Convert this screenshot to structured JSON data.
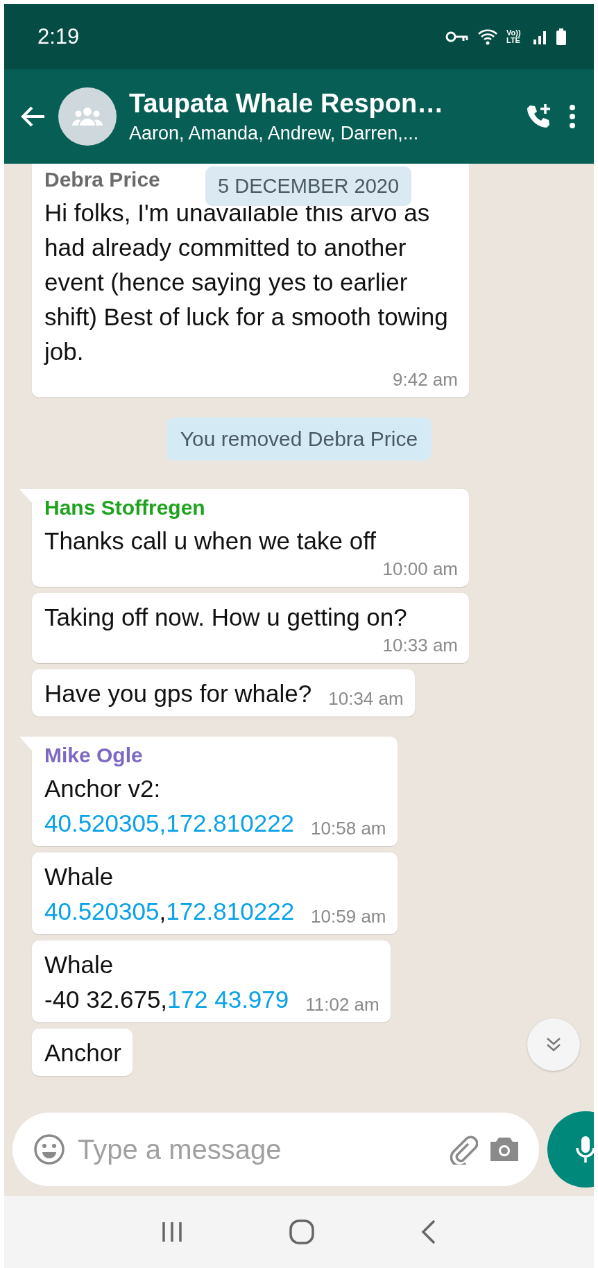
{
  "status_bar": {
    "time": "2:19",
    "volte": "Vo)) LTE"
  },
  "header": {
    "title": "Taupata Whale Respon…",
    "subtitle": "Aaron, Amanda, Andrew, Darren,..."
  },
  "date_chip": "5 DECEMBER 2020",
  "messages": [
    {
      "kind": "incoming",
      "tail": false,
      "sender": "Debra Price",
      "color": "#6b6b6b",
      "lines": [
        [
          {
            "text": "Hi folks, I'm unavailable  this arvo as had already committed to another event (hence saying yes to earlier shift) Best of luck for a smooth towing job.",
            "link": false
          }
        ]
      ],
      "time": "9:42 am"
    },
    {
      "kind": "system",
      "text": "You removed Debra Price"
    },
    {
      "kind": "incoming",
      "tail": true,
      "sender": "Hans Stoffregen",
      "color": "#1fa31f",
      "lines": [
        [
          {
            "text": "Thanks call u when we take off",
            "link": false
          }
        ]
      ],
      "time": "10:00 am"
    },
    {
      "kind": "incoming",
      "tail": false,
      "lines": [
        [
          {
            "text": "Taking off now. How u getting on?",
            "link": false
          }
        ]
      ],
      "time": "10:33 am"
    },
    {
      "kind": "incoming",
      "tail": false,
      "lines": [
        [
          {
            "text": "Have you gps for whale?",
            "link": false
          }
        ]
      ],
      "time": "10:34 am"
    },
    {
      "kind": "incoming",
      "tail": true,
      "sender": "Mike Ogle",
      "color": "#7e69c2",
      "lines": [
        [
          {
            "text": "Anchor v2:",
            "link": false
          }
        ],
        [
          {
            "text": "40.520305,172.810222",
            "link": true
          }
        ]
      ],
      "time": "10:58 am"
    },
    {
      "kind": "incoming",
      "tail": false,
      "lines": [
        [
          {
            "text": "Whale",
            "link": false
          }
        ],
        [
          {
            "text": "40.520305",
            "link": true
          },
          {
            "text": ",",
            "link": false
          },
          {
            "text": "172.810222",
            "link": true
          }
        ]
      ],
      "time": "10:59 am"
    },
    {
      "kind": "incoming",
      "tail": false,
      "lines": [
        [
          {
            "text": "Whale",
            "link": false
          }
        ],
        [
          {
            "text": "-40 32.675,",
            "link": false
          },
          {
            "text": "172 43.979",
            "link": true
          }
        ]
      ],
      "time": "11:02 am"
    },
    {
      "kind": "incoming",
      "tail": false,
      "lines": [
        [
          {
            "text": "Anchor",
            "link": false
          }
        ]
      ]
    }
  ],
  "composer": {
    "placeholder": "Type a message"
  }
}
